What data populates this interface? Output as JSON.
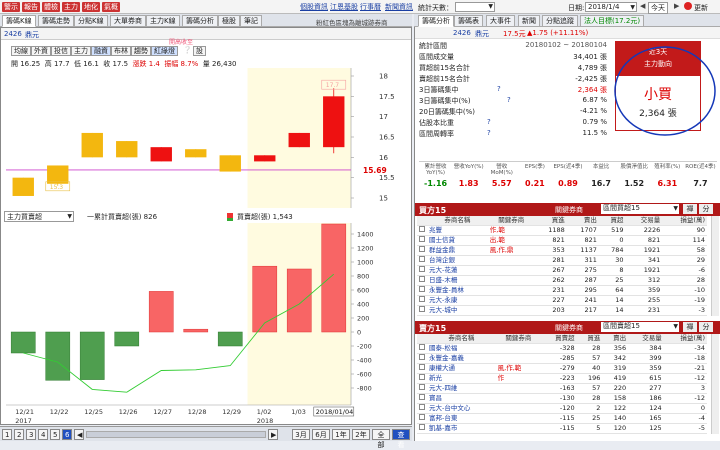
{
  "top": {
    "left_buttons": [
      "警示",
      "報告",
      "體檢",
      "主力",
      "地化",
      "氣概"
    ],
    "links": [
      "個股資訊",
      "江恩基股",
      "行事曆",
      "新聞資訊"
    ],
    "stats_label": "統計天數：",
    "stats_value": "",
    "date_label": "日期:",
    "date_value": "2018/1/4",
    "today_label": "今天",
    "refresh_label": "更新"
  },
  "left_tabs": {
    "labels": [
      "籌碼K線",
      "籌碼走勢",
      "分點K線",
      "大單券商",
      "主力K線",
      "籌碼分析",
      "極股",
      "筆記"
    ],
    "active": 0,
    "note": "粉紅色區塊為離城跡券商"
  },
  "stock": {
    "code": "2426",
    "name": "鼎元"
  },
  "sub_buttons": {
    "labels": [
      "均線",
      "外資",
      "投信",
      "主力",
      "融資",
      "布林",
      "趨勢",
      "紅綠燈",
      "設"
    ],
    "active": 4,
    "active2": 7
  },
  "tooltip": "開高收至 ",
  "ohlc": {
    "open": "開 16.25",
    "high": "高 17.7",
    "low": "低 16.1",
    "close": "收 17.5",
    "chg": "漲跌 1.4",
    "amp": "振幅 8.7%",
    "vol": "量 26,430"
  },
  "price_chart": {
    "y_ticks": [
      "18",
      "17.5",
      "17",
      "16.5",
      "16",
      "15.69",
      "15.5",
      "15"
    ],
    "last_price": "15.69",
    "low_box": "15.3",
    "high_box": "17.7"
  },
  "lower_chart": {
    "selector": "主力買賣超",
    "legend1": "一累計買賣超(張) 826",
    "legend2": "買賣超(張) 1,543",
    "y_ticks": [
      "1400",
      "1200",
      "1000",
      "800",
      "600",
      "400",
      "200",
      "0",
      "-200",
      "-400",
      "-600",
      "-800"
    ],
    "x_labels": [
      "12/21",
      "12/22",
      "12/25",
      "12/26",
      "12/27",
      "12/28",
      "12/29",
      "1/02",
      "1/03",
      "2018/01/04"
    ],
    "year1": "2017",
    "year2": "2018"
  },
  "bottom": {
    "pages": [
      "1",
      "2",
      "3",
      "4",
      "5",
      "6"
    ],
    "active_page": 5,
    "ranges": [
      "3月",
      "6月",
      "1年",
      "2年",
      "全部",
      "查看"
    ]
  },
  "right_tabs": {
    "labels": [
      "籌碼分析",
      "籌碼表",
      "大事件",
      "新聞",
      "分點追蹤",
      "法人目標(17.2元)"
    ],
    "active": 0
  },
  "quote": {
    "code": "2426",
    "name": "鼎元",
    "price": "17.5元",
    "change": "▲1.75 (+11.11%)"
  },
  "stats": [
    {
      "label": "統計區間",
      "value": "20180102 ~ 20180104"
    },
    {
      "label": "區間成交量",
      "value": "34,401 張"
    },
    {
      "label": "買超前15名合計",
      "value": "4,789 張"
    },
    {
      "label": "賣超前15名合計",
      "value": "-2,425 張"
    },
    {
      "label": "3日籌碼集中",
      "value": "2,364 張"
    },
    {
      "label": "3日籌碼集中(%)",
      "value": "6.87 %"
    },
    {
      "label": "20日籌碼集中(%)",
      "value": "-4.21 %"
    },
    {
      "label": "佔股本比重",
      "value": "0.79 %"
    },
    {
      "label": "區間周轉率",
      "value": "11.5 %"
    }
  ],
  "trend_box": {
    "title1": "近3天",
    "title2": "主力動向",
    "big": "小買",
    "amount": "2,364 張"
  },
  "metrics": {
    "headers": [
      "累計營收YoY(%)",
      "營收YoY(%)",
      "營收MoM(%)",
      "EPS(季)",
      "EPS(近4季)",
      "本益比",
      "股價淨值比",
      "殖利率(%)",
      "ROE(近4季)"
    ],
    "values": [
      "-1.16",
      "1.83",
      "5.57",
      "0.21",
      "0.89",
      "16.7",
      "1.52",
      "6.31",
      "7.7"
    ]
  },
  "buy_table": {
    "title": "買方15",
    "rel_label": "關鍵券商",
    "select": "區間買超15",
    "btn1": "禪",
    "btn2": "分",
    "headers": [
      "券商名稱",
      "關鍵券商",
      "買進",
      "賣出",
      "買超",
      "交易量",
      "損益(萬)"
    ],
    "rows": [
      [
        "兆豐",
        "作,範",
        "1188",
        "1707",
        "519",
        "2226",
        "90"
      ],
      [
        "國士信貸",
        "出,範",
        "821",
        "821",
        "0",
        "821",
        "114"
      ],
      [
        "群益金鼎",
        "風,作,鼎",
        "353",
        "1137",
        "784",
        "1921",
        "58"
      ],
      [
        "台灣企銀",
        "",
        "281",
        "311",
        "30",
        "341",
        "29"
      ],
      [
        "元大-花蓮",
        "",
        "267",
        "275",
        "8",
        "1921",
        "-6"
      ],
      [
        "日盛-木柵",
        "",
        "262",
        "287",
        "25",
        "312",
        "28"
      ],
      [
        "永豐金-員林",
        "",
        "231",
        "295",
        "64",
        "359",
        "-10"
      ],
      [
        "元大-永康",
        "",
        "227",
        "241",
        "14",
        "255",
        "-19"
      ],
      [
        "元大-城中",
        "",
        "203",
        "217",
        "14",
        "231",
        "-3"
      ]
    ]
  },
  "sell_table": {
    "title": "賣方15",
    "rel_label": "關鍵券商",
    "select": "區間賣超15",
    "btn1": "禪",
    "btn2": "分",
    "headers": [
      "券商名稱",
      "關鍵券商",
      "買賣超",
      "買進",
      "賣出",
      "交易量",
      "損益(萬)"
    ],
    "rows": [
      [
        "國泰-松福",
        "",
        "-328",
        "28",
        "356",
        "384",
        "-34"
      ],
      [
        "永豐金-嘉義",
        "",
        "-285",
        "57",
        "342",
        "399",
        "-18"
      ],
      [
        "康權大通",
        "風,作,範",
        "-279",
        "40",
        "319",
        "359",
        "-21"
      ],
      [
        "新光",
        "作",
        "-223",
        "196",
        "419",
        "615",
        "-12"
      ],
      [
        "元大-四維",
        "",
        "-163",
        "57",
        "220",
        "277",
        "3"
      ],
      [
        "寶昌",
        "",
        "-130",
        "28",
        "158",
        "186",
        "-12"
      ],
      [
        "元大-台中文心",
        "",
        "-120",
        "2",
        "122",
        "124",
        "0"
      ],
      [
        "富邦-台東",
        "",
        "-115",
        "25",
        "140",
        "165",
        "-4"
      ],
      [
        "凱基-嘉市",
        "",
        "-115",
        "5",
        "120",
        "125",
        "-5"
      ]
    ]
  },
  "chart_data": [
    {
      "type": "bar",
      "title": "",
      "note": "candlestick price chart",
      "categories": [
        "12/21",
        "12/22",
        "12/25",
        "12/26",
        "12/27",
        "12/28",
        "12/29",
        "1/02",
        "1/03",
        "2018/01/04"
      ],
      "series": [
        {
          "name": "open",
          "values": [
            15.5,
            15.8,
            16.6,
            16.4,
            15.9,
            16.2,
            16.05,
            15.9,
            16.25,
            16.25
          ]
        },
        {
          "name": "close",
          "values": [
            15.05,
            15.35,
            16.0,
            16.0,
            16.25,
            16.0,
            15.65,
            16.05,
            16.6,
            17.5
          ]
        },
        {
          "name": "high",
          "values": [
            15.5,
            15.8,
            16.6,
            16.4,
            16.25,
            16.2,
            16.05,
            16.05,
            16.6,
            17.7
          ]
        },
        {
          "name": "low",
          "values": [
            15.05,
            15.3,
            16.0,
            16.0,
            15.9,
            16.0,
            15.65,
            15.9,
            16.25,
            16.1
          ]
        }
      ],
      "ylim": [
        15,
        18
      ],
      "xlabel": "",
      "ylabel": ""
    },
    {
      "type": "bar",
      "title": "",
      "categories": [
        "12/21",
        "12/22",
        "12/25",
        "12/26",
        "12/27",
        "12/28",
        "12/29",
        "1/02",
        "1/03",
        "2018/01/04"
      ],
      "series": [
        {
          "name": "買賣超(張)",
          "values": [
            -300,
            -690,
            -680,
            -200,
            580,
            40,
            -200,
            940,
            900,
            1543
          ]
        },
        {
          "name": "一累計買賣超(張)",
          "values": [
            -300,
            -430,
            -820,
            -860,
            -550,
            -540,
            -480,
            130,
            400,
            826
          ]
        }
      ],
      "ylim": [
        -900,
        1500
      ],
      "xlabel": "",
      "ylabel": ""
    }
  ]
}
